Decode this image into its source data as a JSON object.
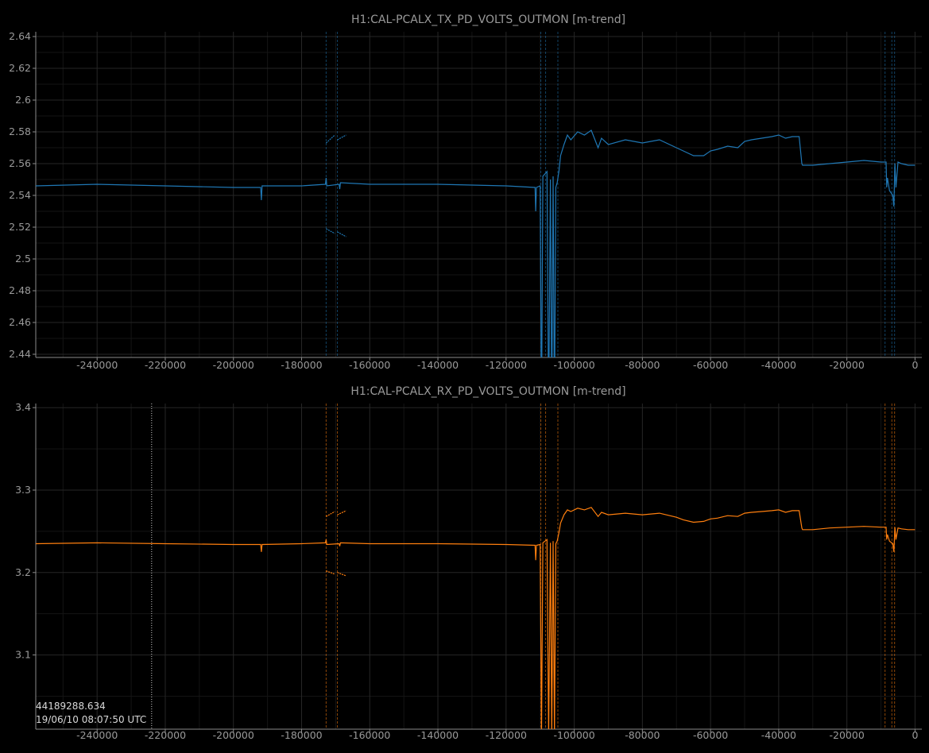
{
  "chart_data": [
    {
      "type": "line",
      "title": "H1:CAL-PCALX_TX_PD_VOLTS_OUTMON [m-trend]",
      "xlabel": "",
      "ylabel": "",
      "xlim": [
        -258000,
        2000
      ],
      "ylim": [
        2.438,
        2.643
      ],
      "x_ticks": [
        -240000,
        -220000,
        -200000,
        -180000,
        -160000,
        -140000,
        -120000,
        -100000,
        -80000,
        -60000,
        -40000,
        -20000,
        0
      ],
      "x_tick_labels": [
        "-240000",
        "-220000",
        "-200000",
        "-180000",
        "-160000",
        "-140000",
        "-120000",
        "-100000",
        "-80000",
        "-60000",
        "-40000",
        "-20000",
        "0"
      ],
      "y_ticks": [
        2.44,
        2.46,
        2.48,
        2.5,
        2.52,
        2.54,
        2.56,
        2.58,
        2.6,
        2.62,
        2.64
      ],
      "y_tick_labels": [
        "2.44",
        "2.46",
        "2.48",
        "2.5",
        "2.52",
        "2.54",
        "2.56",
        "2.58",
        "2.6",
        "2.62",
        "2.64"
      ],
      "grid": true,
      "color": "#1f77b4",
      "series": [
        {
          "x": [
            -258000,
            -240000,
            -220000,
            -200000,
            -192000,
            -191800,
            -191600,
            -180000,
            -173000,
            -172800,
            -172600,
            -169000,
            -168800,
            -168600,
            -160000,
            -140000,
            -120000,
            -111500,
            -111300,
            -111100,
            -110000,
            -109600,
            -109200,
            -108000,
            -107500,
            -107000,
            -106600,
            -106200,
            -105800,
            -105400,
            -105000,
            -104500,
            -104000,
            -103000,
            -102000,
            -101000,
            -99000,
            -97000,
            -95000,
            -93000,
            -92000,
            -90000,
            -85000,
            -80000,
            -75000,
            -70000,
            -68000,
            -65000,
            -62000,
            -60000,
            -58000,
            -55000,
            -52000,
            -50000,
            -48000,
            -45000,
            -42000,
            -40000,
            -38000,
            -36000,
            -34000,
            -33200,
            -33000,
            -30000,
            -25000,
            -20000,
            -15000,
            -10000,
            -8500,
            -8300,
            -8100,
            -7500,
            -6500,
            -6200,
            -5900,
            -5600,
            -5000,
            -4000,
            -2000,
            0
          ],
          "y": [
            2.546,
            2.547,
            2.546,
            2.545,
            2.545,
            2.537,
            2.546,
            2.546,
            2.547,
            2.551,
            2.546,
            2.547,
            2.544,
            2.548,
            2.547,
            2.547,
            2.546,
            2.545,
            2.53,
            2.545,
            2.546,
            2.4,
            2.552,
            2.555,
            2.4,
            2.55,
            2.4,
            2.552,
            2.4,
            2.545,
            2.548,
            2.555,
            2.565,
            2.572,
            2.578,
            2.575,
            2.58,
            2.578,
            2.581,
            2.57,
            2.576,
            2.572,
            2.575,
            2.573,
            2.575,
            2.57,
            2.568,
            2.565,
            2.565,
            2.568,
            2.569,
            2.571,
            2.57,
            2.574,
            2.575,
            2.576,
            2.577,
            2.578,
            2.576,
            2.577,
            2.577,
            2.56,
            2.559,
            2.559,
            2.56,
            2.561,
            2.562,
            2.561,
            2.561,
            2.545,
            2.551,
            2.543,
            2.54,
            2.533,
            2.56,
            2.545,
            2.561,
            2.56,
            2.559,
            2.559
          ]
        }
      ],
      "dashed_segments": [
        {
          "x": -172800,
          "y": [
            2.573,
            2.578
          ]
        },
        {
          "x": -169500,
          "y": [
            2.575,
            2.578
          ]
        },
        {
          "x": -172800,
          "y": [
            2.519,
            2.516
          ]
        },
        {
          "x": -169500,
          "y": [
            2.517,
            2.514
          ]
        }
      ]
    },
    {
      "type": "line",
      "title": "H1:CAL-PCALX_RX_PD_VOLTS_OUTMON [m-trend]",
      "xlabel": "",
      "ylabel": "",
      "xlim": [
        -258000,
        2000
      ],
      "ylim": [
        3.01,
        3.405
      ],
      "x_ticks": [
        -240000,
        -220000,
        -200000,
        -180000,
        -160000,
        -140000,
        -120000,
        -100000,
        -80000,
        -60000,
        -40000,
        -20000,
        0
      ],
      "x_tick_labels": [
        "-240000",
        "-220000",
        "-200000",
        "-180000",
        "-160000",
        "-140000",
        "-120000",
        "-100000",
        "-80000",
        "-60000",
        "-40000",
        "-20000",
        "0"
      ],
      "y_ticks": [
        3.1,
        3.2,
        3.3,
        3.4
      ],
      "y_tick_labels": [
        "3.1",
        "3.2",
        "3.3",
        "3.4"
      ],
      "grid": true,
      "color": "#ff7f0e",
      "series": [
        {
          "x": [
            -258000,
            -240000,
            -220000,
            -200000,
            -192000,
            -191800,
            -191600,
            -180000,
            -173000,
            -172800,
            -172600,
            -169000,
            -168800,
            -168600,
            -160000,
            -140000,
            -120000,
            -111500,
            -111300,
            -111100,
            -110000,
            -109600,
            -109200,
            -108000,
            -107500,
            -107000,
            -106600,
            -106200,
            -105800,
            -105400,
            -105000,
            -104500,
            -104000,
            -103000,
            -102000,
            -101000,
            -99000,
            -97000,
            -95000,
            -93000,
            -92000,
            -90000,
            -85000,
            -80000,
            -75000,
            -70000,
            -68000,
            -65000,
            -62000,
            -60000,
            -58000,
            -55000,
            -52000,
            -50000,
            -48000,
            -45000,
            -42000,
            -40000,
            -38000,
            -36000,
            -34000,
            -33200,
            -33000,
            -30000,
            -25000,
            -20000,
            -15000,
            -10000,
            -8500,
            -8300,
            -8100,
            -7500,
            -6500,
            -6200,
            -5900,
            -5600,
            -5000,
            -4000,
            -2000,
            0
          ],
          "y": [
            3.235,
            3.236,
            3.235,
            3.234,
            3.234,
            3.225,
            3.234,
            3.235,
            3.236,
            3.24,
            3.234,
            3.235,
            3.232,
            3.236,
            3.235,
            3.235,
            3.234,
            3.233,
            3.215,
            3.233,
            3.234,
            3.0,
            3.236,
            3.24,
            3.0,
            3.236,
            3.0,
            3.238,
            3.0,
            3.235,
            3.238,
            3.248,
            3.26,
            3.27,
            3.276,
            3.274,
            3.278,
            3.276,
            3.279,
            3.268,
            3.273,
            3.27,
            3.272,
            3.27,
            3.272,
            3.267,
            3.264,
            3.261,
            3.262,
            3.265,
            3.266,
            3.269,
            3.268,
            3.272,
            3.273,
            3.274,
            3.275,
            3.276,
            3.273,
            3.275,
            3.275,
            3.254,
            3.252,
            3.252,
            3.254,
            3.255,
            3.256,
            3.255,
            3.255,
            3.24,
            3.246,
            3.238,
            3.235,
            3.225,
            3.255,
            3.24,
            3.254,
            3.253,
            3.252,
            3.252
          ]
        }
      ],
      "dashed_segments": [
        {
          "x": -172800,
          "y": [
            3.268,
            3.274
          ]
        },
        {
          "x": -169500,
          "y": [
            3.27,
            3.275
          ]
        },
        {
          "x": -172800,
          "y": [
            3.202,
            3.198
          ]
        },
        {
          "x": -169500,
          "y": [
            3.2,
            3.196
          ]
        }
      ]
    }
  ],
  "cursor": {
    "value": "44189288.634",
    "timestamp": "19/06/10 08:07:50 UTC",
    "x": -224000
  }
}
